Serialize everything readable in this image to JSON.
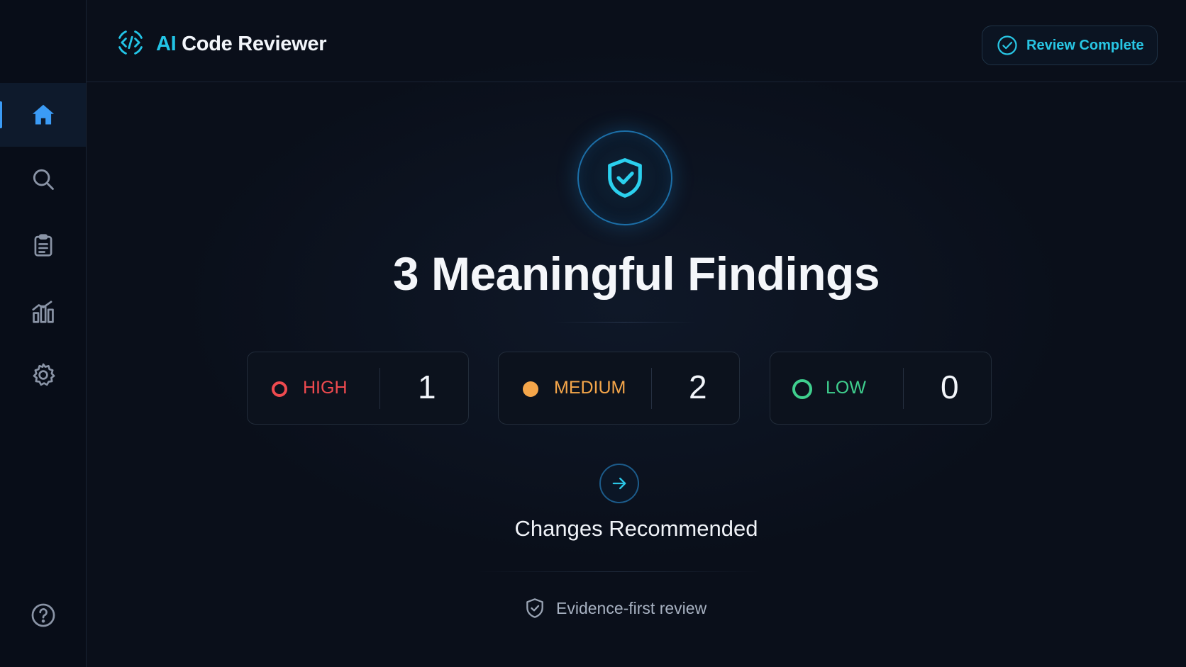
{
  "app": {
    "title_accent": "AI",
    "title_rest": " Code Reviewer",
    "status_label": "Review Complete"
  },
  "sidebar": {
    "items": [
      {
        "icon": "home-icon",
        "active": true
      },
      {
        "icon": "search-icon",
        "active": false
      },
      {
        "icon": "clipboard-icon",
        "active": false
      },
      {
        "icon": "bar-chart-icon",
        "active": false
      },
      {
        "icon": "gear-icon",
        "active": false
      }
    ],
    "help_icon": "help-icon"
  },
  "main": {
    "headline": "3 Meaningful Findings",
    "severity": [
      {
        "label": "HIGH",
        "count": "1",
        "color": "#ef4a4f"
      },
      {
        "label": "MEDIUM",
        "count": "2",
        "color": "#f5a64a"
      },
      {
        "label": "LOW",
        "count": "0",
        "color": "#3fcf8e"
      }
    ],
    "recommendation": "Changes Recommended",
    "footer_note": "Evidence-first review"
  },
  "colors": {
    "accent": "#22c4e6",
    "active_nav": "#3b9bf5",
    "background": "#0a0f1a"
  }
}
